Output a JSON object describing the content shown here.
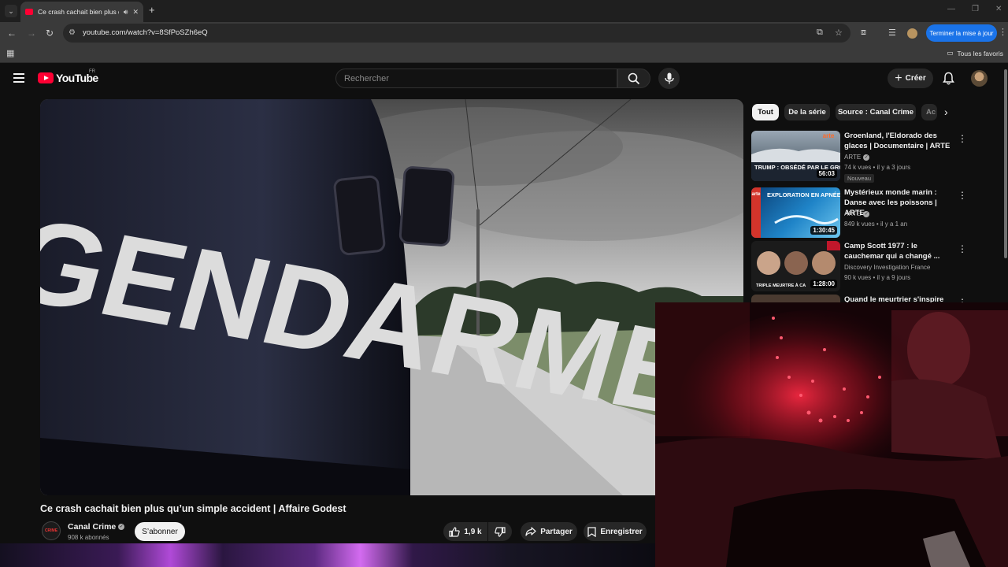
{
  "browser": {
    "tab_title": "Ce crash cachait bien plus q",
    "url": "youtube.com/watch?v=8SfPoSZh6eQ",
    "update_button": "Terminer la mise à jour",
    "all_bookmarks": "Tous les favoris"
  },
  "youtube": {
    "logo_text": "YouTube",
    "region": "FR",
    "search_placeholder": "Rechercher",
    "create_label": "Créer"
  },
  "video": {
    "title": "Ce crash cachait bien plus qu’un simple accident | Affaire Godest",
    "channel_name": "Canal Crime",
    "channel_avatar_text": "CRIME",
    "subscribers": "908 k abonnés",
    "subscribe_label": "S’abonner",
    "likes": "1,9 k",
    "share_label": "Partager",
    "save_label": "Enregistrer",
    "frame_text": "GENDARMERIE"
  },
  "chips": [
    "Tout",
    "De la série",
    "Source : Canal Crime",
    "Ac"
  ],
  "recommendations": [
    {
      "title": "Groenland, l'Eldorado des glaces | Documentaire | ARTE",
      "channel": "ARTE",
      "verified": true,
      "views": "74 k vues",
      "age": "il y a 3 jours",
      "badge": "Nouveau",
      "duration": "56:03",
      "thumb_text": "TRUMP : OBSÉDÉ PAR LE GROENL",
      "thumb_logo": "arte"
    },
    {
      "title": "Mystérieux monde marin : Danse avec les poissons | ARTE",
      "channel": "ARTE",
      "verified": true,
      "views": "849 k vues",
      "age": "il y a 1 an",
      "duration": "1:30:45",
      "thumb_text": "EXPLORATION EN APNÉE",
      "thumb_logo": "arte"
    },
    {
      "title": "Camp Scott 1977 : le cauchemar qui a changé ...",
      "channel": "Discovery Investigation France",
      "verified": false,
      "views": "90 k vues",
      "age": "il y a 9 jours",
      "duration": "1:28:00",
      "thumb_text": "TRIPLE MEURTRE À CA"
    },
    {
      "title": "Quand le meurtrier s'inspire de",
      "channel": "",
      "views": "",
      "age": ""
    }
  ],
  "colors": {
    "yt_red": "#ff0033",
    "background": "#0f0f0f",
    "update_blue": "#1a73e8"
  }
}
